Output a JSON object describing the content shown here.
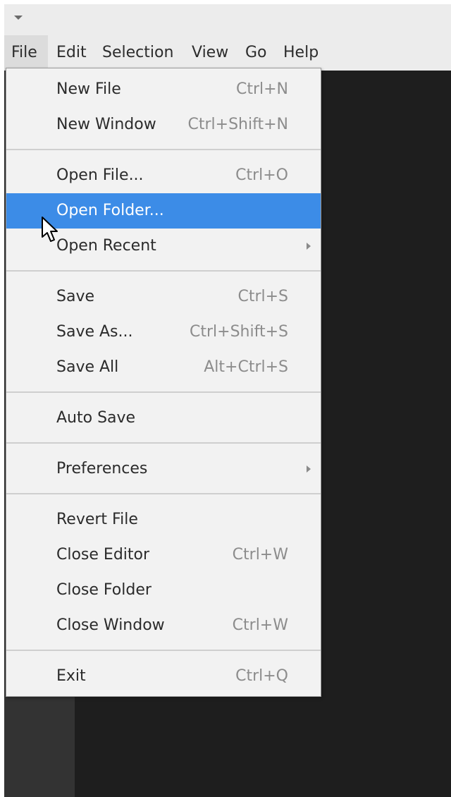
{
  "menubar": {
    "items": [
      "File",
      "Edit",
      "Selection",
      "View",
      "Go",
      "Help"
    ]
  },
  "file_menu": {
    "items": [
      {
        "label": "New File",
        "shortcut": "Ctrl+N"
      },
      {
        "label": "New Window",
        "shortcut": "Ctrl+Shift+N"
      },
      {
        "label": "Open File...",
        "shortcut": "Ctrl+O"
      },
      {
        "label": "Open Folder...",
        "shortcut": ""
      },
      {
        "label": "Open Recent",
        "shortcut": ""
      },
      {
        "label": "Save",
        "shortcut": "Ctrl+S"
      },
      {
        "label": "Save As...",
        "shortcut": "Ctrl+Shift+S"
      },
      {
        "label": "Save All",
        "shortcut": "Alt+Ctrl+S"
      },
      {
        "label": "Auto Save",
        "shortcut": ""
      },
      {
        "label": "Preferences",
        "shortcut": ""
      },
      {
        "label": "Revert File",
        "shortcut": ""
      },
      {
        "label": "Close Editor",
        "shortcut": "Ctrl+W"
      },
      {
        "label": "Close Folder",
        "shortcut": ""
      },
      {
        "label": "Close Window",
        "shortcut": "Ctrl+W"
      },
      {
        "label": "Exit",
        "shortcut": "Ctrl+Q"
      }
    ],
    "highlighted_item": "Open Folder...",
    "submenu_items": [
      "Open Recent",
      "Preferences"
    ]
  },
  "colors": {
    "highlight": "#3c8ce7",
    "menu_bg": "#f2f2f2",
    "editor_bg": "#1e1e1e",
    "sidebar_bg": "#333333"
  },
  "icons": {
    "window_menu": "chevron-down-icon",
    "submenu": "chevron-right-icon",
    "pointer": "mouse-cursor-icon"
  }
}
